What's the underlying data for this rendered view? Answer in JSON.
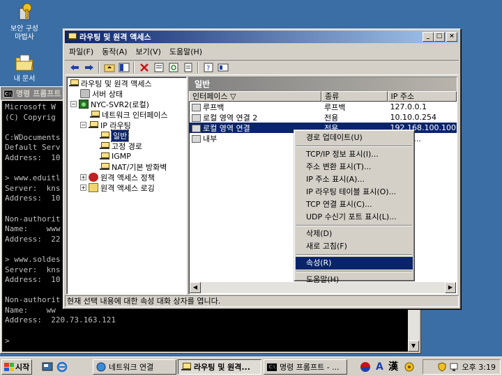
{
  "desktop": {
    "icons": [
      {
        "label_line1": "보안 구성",
        "label_line2": "마법사",
        "icon": "security-wizard-icon"
      },
      {
        "label": "내 문서",
        "icon": "my-documents-icon"
      }
    ]
  },
  "console": {
    "title": "명령 프롬프트",
    "lines": [
      "Microsoft W",
      "(C) Copyrig",
      "",
      "C:WDocuments",
      "Default Serv",
      "Address:  10",
      "",
      "> www.eduitl",
      "Server:  kns",
      "Address:  10",
      "",
      "Non-authorit",
      "Name:    www",
      "Address:  22",
      "",
      "> www.soldes",
      "Server:  kns",
      "Address:  10",
      "",
      "Non-authorit",
      "Name:    ww",
      "Address:  220.73.163.121",
      "",
      ">"
    ]
  },
  "rras": {
    "title": "라우팅 및 원격 액세스",
    "menu": [
      "파일(F)",
      "동작(A)",
      "보기(V)",
      "도움말(H)"
    ],
    "tree": [
      {
        "label": "라우팅 및 원격 액세스",
        "level": 0,
        "icon": "rras-icon"
      },
      {
        "label": "서버 상태",
        "level": 1,
        "icon": "server-status-icon"
      },
      {
        "label": "NYC-SVR2(로컬)",
        "level": 1,
        "icon": "server-icon",
        "expander": "−"
      },
      {
        "label": "네트워크 인터페이스",
        "level": 2,
        "icon": "network-interface-icon"
      },
      {
        "label": "IP 라우팅",
        "level": 2,
        "icon": "ip-routing-icon",
        "expander": "−"
      },
      {
        "label": "일반",
        "level": 3,
        "icon": "general-icon",
        "selected": true
      },
      {
        "label": "고정 경로",
        "level": 3,
        "icon": "static-routes-icon"
      },
      {
        "label": "IGMP",
        "level": 3,
        "icon": "igmp-icon"
      },
      {
        "label": "NAT/기본 방화벽",
        "level": 3,
        "icon": "nat-firewall-icon"
      },
      {
        "label": "원격 액세스 정책",
        "level": 2,
        "icon": "remote-access-policy-icon",
        "expander": "+"
      },
      {
        "label": "원격 액세스 로깅",
        "level": 2,
        "icon": "remote-access-logging-icon",
        "expander": "+"
      }
    ],
    "pane_title": "일반",
    "columns": [
      "인터페이스 ▽",
      "종류",
      "IP 주소"
    ],
    "rows": [
      {
        "cells": [
          "루프백",
          "루프백",
          "127.0.0.1"
        ]
      },
      {
        "cells": [
          "로컬 영역 연결 2",
          "전용",
          "10.10.0.254"
        ]
      },
      {
        "cells": [
          "로컬 영역 연결",
          "전용",
          "192.168.100.100"
        ],
        "selected": true
      },
      {
        "cells": [
          "내부",
          "",
          "수 없음..."
        ]
      }
    ],
    "status": "현재 선택 내용에 대한 속성 대화 상자를 엽니다."
  },
  "context_menu": {
    "groups": [
      [
        "경로 업데이트(U)"
      ],
      [
        "TCP/IP 정보 표시(I)...",
        "주소 변환 표시(T)...",
        "IP 주소 표시(A)...",
        "IP 라우팅 테이블 표시(O)...",
        "TCP 연결 표시(C)...",
        "UDP 수신기 포트 표시(L)..."
      ],
      [
        "삭제(D)",
        "새로 고침(F)"
      ],
      [
        "속성(R)"
      ],
      [
        "도움말(H)"
      ]
    ],
    "highlighted": "속성(R)"
  },
  "taskbar": {
    "start": "시작",
    "tasks": [
      {
        "label": "네트워크 연결",
        "active": false
      },
      {
        "label": "라우팅 및 원격...",
        "active": true
      },
      {
        "label": "명령 프롬프트 - ...",
        "active": false
      }
    ],
    "ime": [
      "A",
      "漢"
    ],
    "clock": "오후 3:19"
  }
}
